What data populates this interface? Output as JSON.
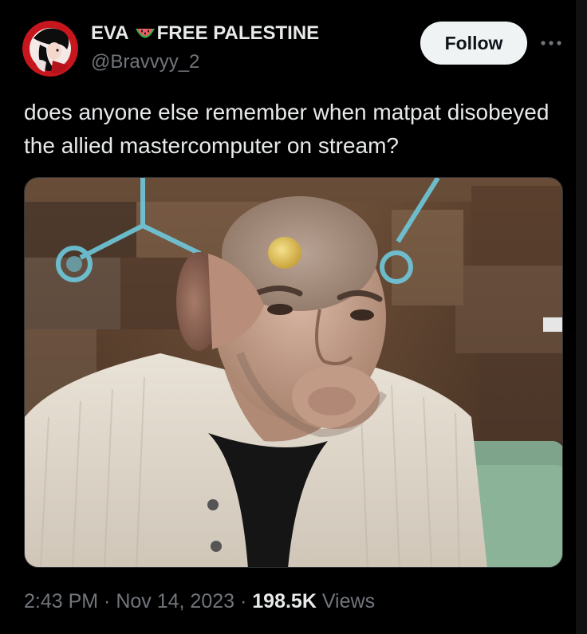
{
  "author": {
    "name_part1": "EVA",
    "name_part2": "FREE PALESTINE",
    "name_emoji_icon": "watermelon-icon",
    "handle": "@Bravvyy_2"
  },
  "actions": {
    "follow_label": "Follow",
    "more_icon": "more-horizontal-icon"
  },
  "tweet": {
    "text": "does anyone else remember when matpat disobeyed the allied mastercomputer on stream?"
  },
  "meta": {
    "time": "2:43 PM",
    "separator1": " · ",
    "date": "Nov 14, 2023",
    "separator2": " · ",
    "views_count": "198.5K",
    "views_label": " Views"
  },
  "colors": {
    "background": "#000000",
    "text_primary": "#e7e9ea",
    "text_secondary": "#71767b",
    "follow_bg": "#eff3f4"
  }
}
